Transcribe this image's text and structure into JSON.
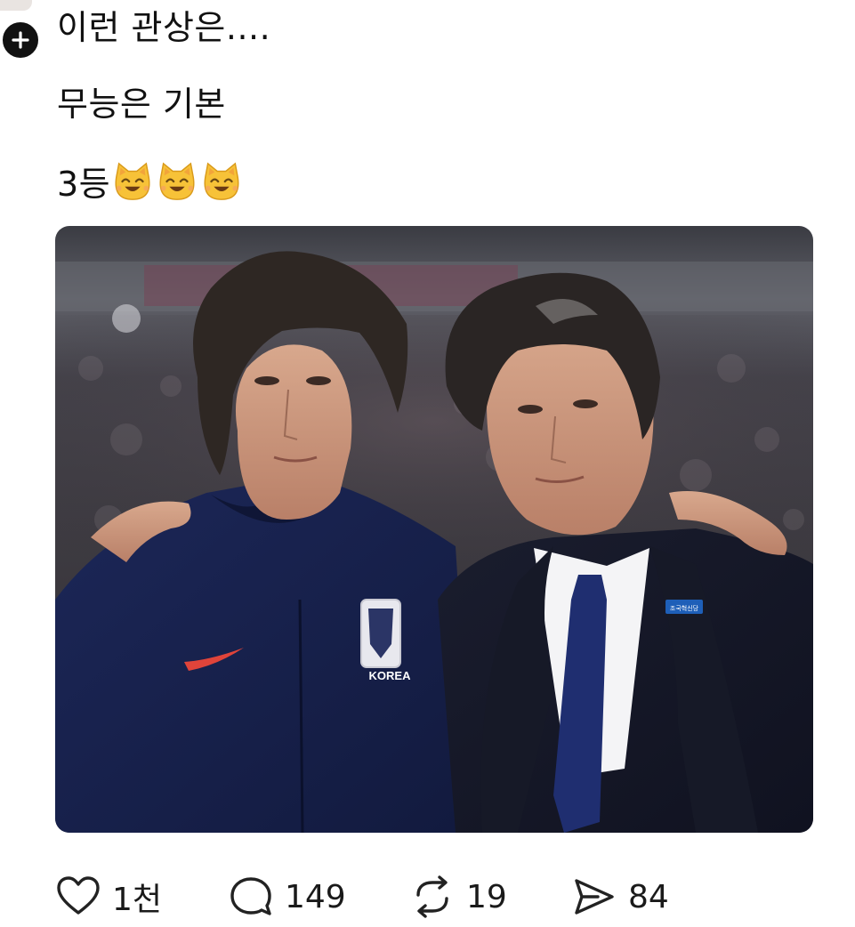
{
  "post": {
    "lines": [
      "이런 관상은....",
      "무능은 기본",
      "3등"
    ],
    "emojis": [
      "😸",
      "😸",
      "😸"
    ]
  },
  "photo": {
    "badge_text": "KOREA",
    "pin_text": "조국혁신당"
  },
  "actions": {
    "like_count": "1천",
    "reply_count": "149",
    "repost_count": "19",
    "share_count": "84"
  }
}
